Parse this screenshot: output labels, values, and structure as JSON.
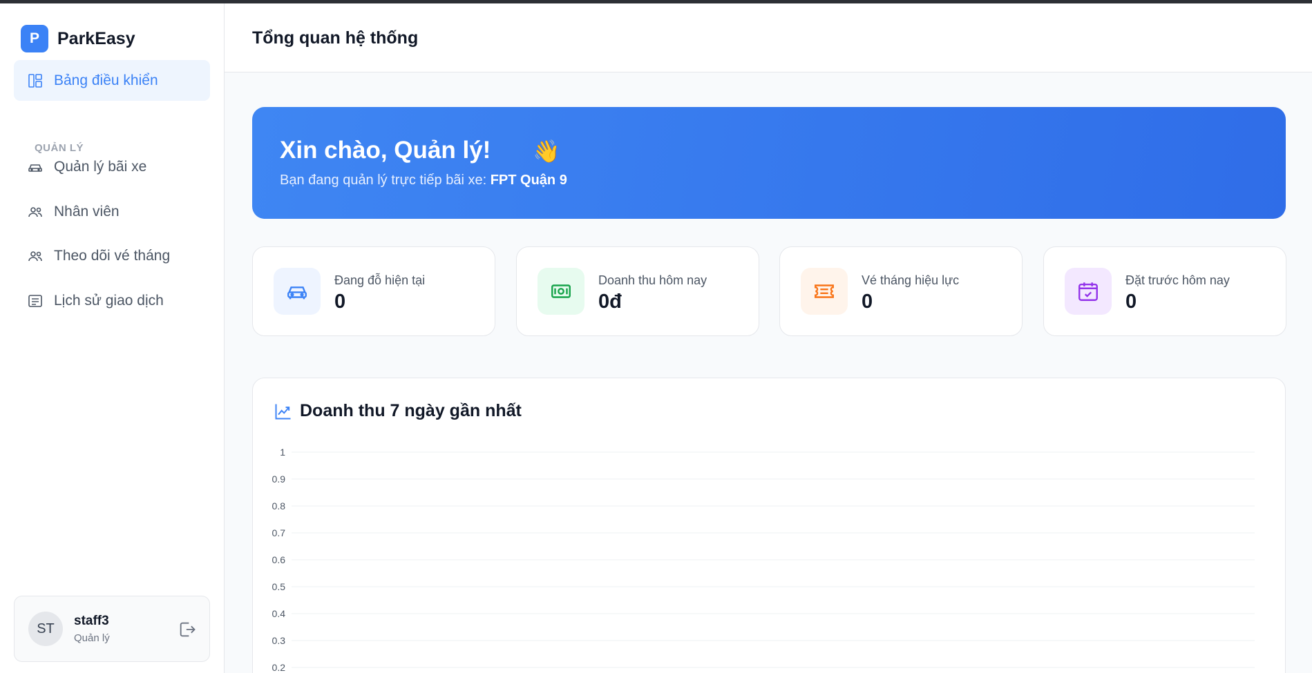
{
  "app": {
    "brand_initial": "P",
    "brand_name": "ParkEasy"
  },
  "sidebar": {
    "dashboard_label": "Bảng điều khiển",
    "section_label": "QUẢN LÝ",
    "items": [
      {
        "label": "Quản lý bãi xe",
        "icon": "car-icon"
      },
      {
        "label": "Nhân viên",
        "icon": "users-icon"
      },
      {
        "label": "Theo dõi vé tháng",
        "icon": "users-icon"
      },
      {
        "label": "Lịch sử giao dịch",
        "icon": "receipt-icon"
      }
    ]
  },
  "user": {
    "initials": "ST",
    "name": "staff3",
    "role": "Quản lý"
  },
  "header": {
    "title": "Tổng quan hệ thống"
  },
  "hero": {
    "greeting": "Xin chào, Quản lý!",
    "wave": "👋",
    "subtitle_prefix": "Bạn đang quản lý trực tiếp bãi xe: ",
    "lot_name": "FPT Quận 9"
  },
  "stats": [
    {
      "label": "Đang đỗ hiện tại",
      "value": "0",
      "icon": "car-icon",
      "color": "#3b82f6",
      "bg": "#eef4ff"
    },
    {
      "label": "Doanh thu hôm nay",
      "value": "0đ",
      "icon": "cash-icon",
      "color": "#16a34a",
      "bg": "#e7fbef"
    },
    {
      "label": "Vé tháng hiệu lực",
      "value": "0",
      "icon": "ticket-icon",
      "color": "#f97316",
      "bg": "#fff4eb"
    },
    {
      "label": "Đặt trước hôm nay",
      "value": "0",
      "icon": "calendar-check-icon",
      "color": "#9333ea",
      "bg": "#f3e8ff"
    }
  ],
  "chart": {
    "title": "Doanh thu 7 ngày gần nhất",
    "icon": "trending-up-icon"
  },
  "chart_data": {
    "type": "line",
    "title": "Doanh thu 7 ngày gần nhất",
    "xlabel": "",
    "ylabel": "",
    "y_ticks": [
      "1",
      "0.9",
      "0.8",
      "0.7",
      "0.6",
      "0.5",
      "0.4",
      "0.3",
      "0.2"
    ],
    "ylim": [
      0,
      1
    ],
    "grid": true,
    "series": []
  }
}
